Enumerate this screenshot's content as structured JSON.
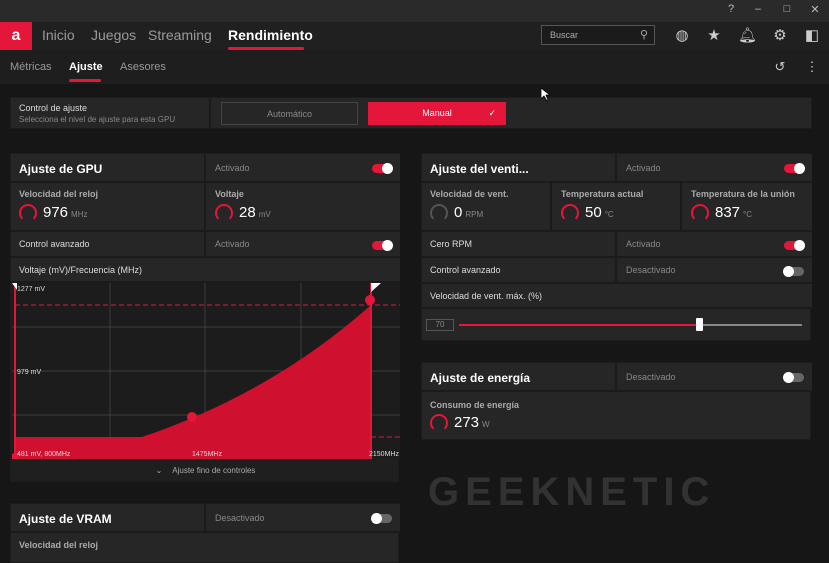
{
  "window": {
    "help": "?",
    "minimize": "–",
    "maximize": "□",
    "close": "✕"
  },
  "nav": {
    "logo": "a",
    "items": [
      "Inicio",
      "Juegos",
      "Streaming",
      "Rendimiento"
    ],
    "active": "Rendimiento",
    "search_placeholder": "Buscar"
  },
  "subnav": {
    "items": [
      "Métricas",
      "Ajuste",
      "Asesores"
    ],
    "active": "Ajuste"
  },
  "control": {
    "title": "Control de ajuste",
    "subtitle": "Selecciona el nivel de ajuste para esta GPU",
    "auto": "Automático",
    "manual": "Manual",
    "selected": "Manual"
  },
  "gpu": {
    "title": "Ajuste de GPU",
    "state": "Activado",
    "enabled": true,
    "clock_label": "Velocidad del reloj",
    "clock_value": "976",
    "clock_unit": "MHz",
    "volt_label": "Voltaje",
    "volt_value": "28",
    "volt_unit": "mV",
    "adv_label": "Control avanzado",
    "adv_state": "Activado",
    "adv_enabled": true,
    "curve_label": "Voltaje (mV)/Frecuencia (MHz)",
    "curve": {
      "y_top": "1277 mV",
      "y_mid": "979 mV",
      "start": "481 mV, 800MHz",
      "mid_x": "1475MHz",
      "end_x": "2150MHz"
    },
    "fine": "Ajuste fino de controles"
  },
  "fan": {
    "title": "Ajuste del venti...",
    "state": "Activado",
    "enabled": true,
    "speed_label": "Velocidad de vent.",
    "speed_value": "0",
    "speed_unit": "RPM",
    "temp_label": "Temperatura actual",
    "temp_value": "50",
    "temp_unit": "°C",
    "junction_label": "Temperatura de la unión",
    "junction_value": "837",
    "junction_unit": "°C",
    "zero_label": "Cero RPM",
    "zero_state": "Activado",
    "zero_enabled": true,
    "adv_label": "Control avanzado",
    "adv_state": "Desactivado",
    "adv_enabled": false,
    "max_label": "Velocidad de vent. máx. (%)",
    "max_value": "70",
    "max_percent": 70
  },
  "energy": {
    "title": "Ajuste de energía",
    "state": "Desactivado",
    "enabled": false,
    "power_label": "Consumo de energía",
    "power_value": "273",
    "power_unit": "W"
  },
  "vram": {
    "title": "Ajuste de VRAM",
    "state": "Desactivado",
    "enabled": false,
    "clock_label": "Velocidad del reloj"
  },
  "watermark": "GEEKNETIC",
  "colors": {
    "accent": "#e4163a"
  }
}
